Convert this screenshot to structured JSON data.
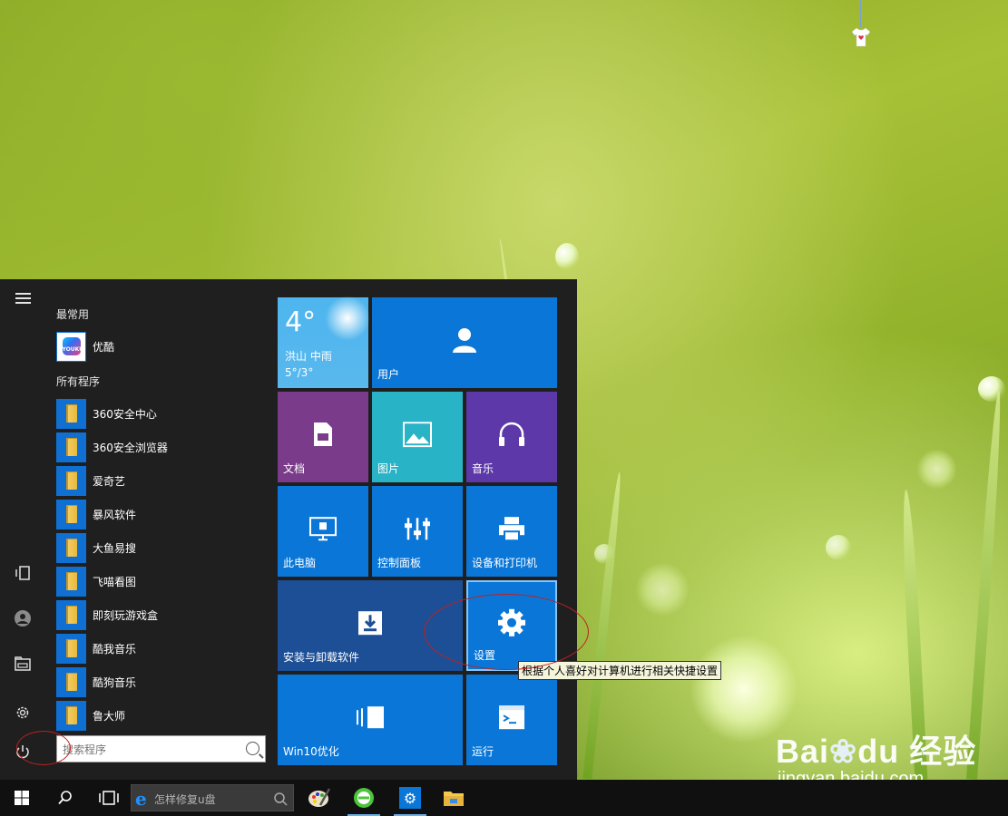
{
  "start_menu": {
    "most_used_label": "最常用",
    "most_used": [
      {
        "name": "优酷",
        "icon": "youku-icon"
      }
    ],
    "all_programs_label": "所有程序",
    "programs": [
      {
        "name": "360安全中心"
      },
      {
        "name": "360安全浏览器"
      },
      {
        "name": "爱奇艺"
      },
      {
        "name": "暴风软件"
      },
      {
        "name": "大鱼易搜"
      },
      {
        "name": "飞喵看图"
      },
      {
        "name": "即刻玩游戏盒"
      },
      {
        "name": "酷我音乐"
      },
      {
        "name": "酷狗音乐"
      },
      {
        "name": "鲁大师"
      }
    ],
    "search_placeholder": "搜索程序",
    "youku_logo_text": "YOUKU"
  },
  "tiles": {
    "weather": {
      "temp": "4°",
      "location": "洪山",
      "condition": "中雨",
      "range": "5°/3°"
    },
    "user": "用户",
    "docs": "文档",
    "pictures": "图片",
    "music": "音乐",
    "this_pc": "此电脑",
    "control_panel": "控制面板",
    "devices_printers": "设备和打印机",
    "install_uninstall": "安装与卸载软件",
    "settings": "设置",
    "win10_optimize": "Win10优化",
    "run": "运行"
  },
  "tooltip": "根据个人喜好对计算机进行相关快捷设置",
  "taskbar": {
    "search_text": "怎样修复u盘"
  },
  "watermark": {
    "brand": "Bai",
    "brand2": "du",
    "cn": "经验",
    "url": "jingyan.baidu.com"
  },
  "colors": {
    "tile_blue": "#0a77d8",
    "tile_purple": "#7a3c8a",
    "tile_teal": "#28b3c6",
    "tile_violet": "#5d38a8",
    "tile_dark": "#1c4f96",
    "weather": "#4eb5ee"
  }
}
